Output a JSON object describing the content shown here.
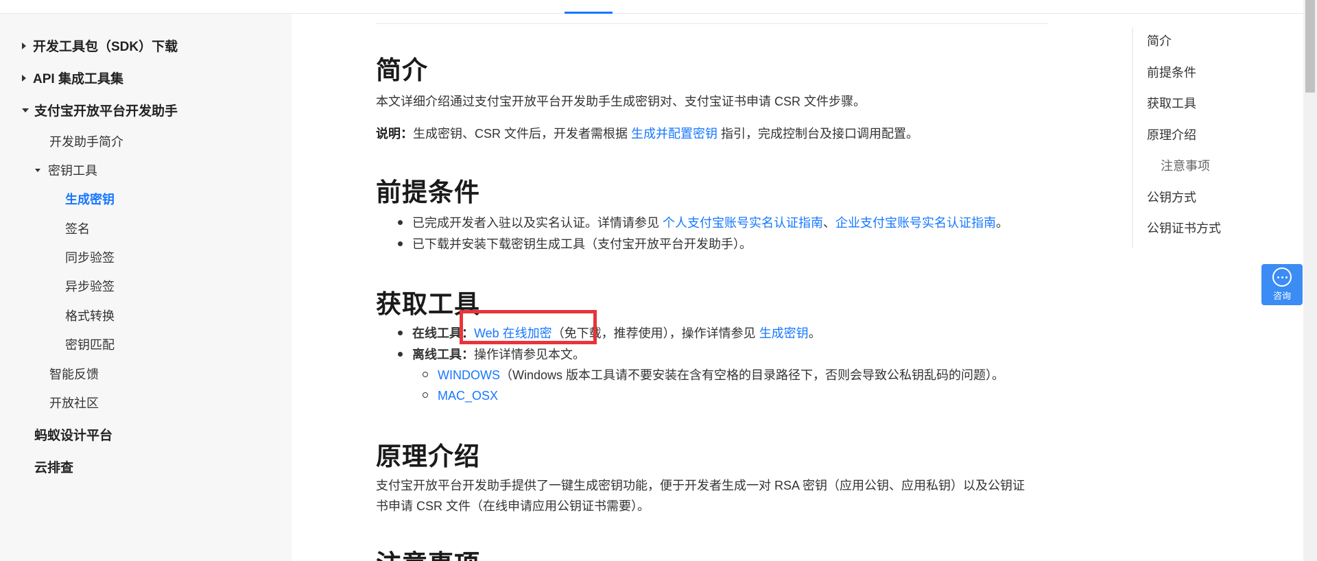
{
  "sidebar": {
    "items": [
      {
        "label": "开发工具包（SDK）下载"
      },
      {
        "label": "API 集成工具集"
      },
      {
        "label": "支付宝开放平台开发助手"
      },
      {
        "label": "开发助手简介"
      },
      {
        "label": "密钥工具"
      },
      {
        "label": "生成密钥"
      },
      {
        "label": "签名"
      },
      {
        "label": "同步验签"
      },
      {
        "label": "异步验签"
      },
      {
        "label": "格式转换"
      },
      {
        "label": "密钥匹配"
      },
      {
        "label": "智能反馈"
      },
      {
        "label": "开放社区"
      },
      {
        "label": "蚂蚁设计平台"
      },
      {
        "label": "云排查"
      }
    ]
  },
  "content": {
    "intro": {
      "title": "简介",
      "text": "本文详细介绍通过支付宝开放平台开发助手生成密钥对、支付宝证书申请 CSR 文件步骤。",
      "note_label": "说明：",
      "note_pre": "生成密钥、CSR 文件后，开发者需根据 ",
      "note_link": "生成并配置密钥",
      "note_post": " 指引，完成控制台及接口调用配置。"
    },
    "prereq": {
      "title": "前提条件",
      "b1_pre": "已完成开发者入驻以及实名认证。详情请参见 ",
      "b1_link1": "个人支付宝账号实名认证指南",
      "b1_sep": "、",
      "b1_link2": "企业支付宝账号实名认证指南",
      "b1_post": "。",
      "b2": "已下载并安装下载密钥生成工具（支付宝开放平台开发助手）。"
    },
    "tools": {
      "title": "获取工具",
      "online_label": "在线工具：",
      "online_link": "Web 在线加密",
      "online_mid": "（免下载，推荐使用），操作详情参见 ",
      "online_link2": "生成密钥",
      "online_post": "。",
      "offline_label": "离线工具：",
      "offline_text": "操作详情参见本文。",
      "win_link": "WINDOWS",
      "win_text": "（Windows 版本工具请不要安装在含有空格的目录路径下，否则会导致公私钥乱码的问题）。",
      "mac_link": "MAC_OSX"
    },
    "principle": {
      "title": "原理介绍",
      "line1": "支付宝开放平台开发助手提供了一键生成密钥功能，便于开发者生成一对 RSA 密钥（应用公钥、应用私钥）以及公钥证",
      "line2": "书申请 CSR 文件（在线申请应用公钥证书需要）。"
    },
    "notes": {
      "title": "注意事项"
    }
  },
  "toc": {
    "items": [
      {
        "label": "简介"
      },
      {
        "label": "前提条件"
      },
      {
        "label": "获取工具"
      },
      {
        "label": "原理介绍"
      },
      {
        "label": "注意事项"
      },
      {
        "label": "公钥方式"
      },
      {
        "label": "公钥证书方式"
      }
    ]
  },
  "consult": {
    "label": "咨询"
  },
  "colors": {
    "accent": "#1677ff",
    "highlight": "#e8343a",
    "consult_bg": "#3b8cf5"
  }
}
